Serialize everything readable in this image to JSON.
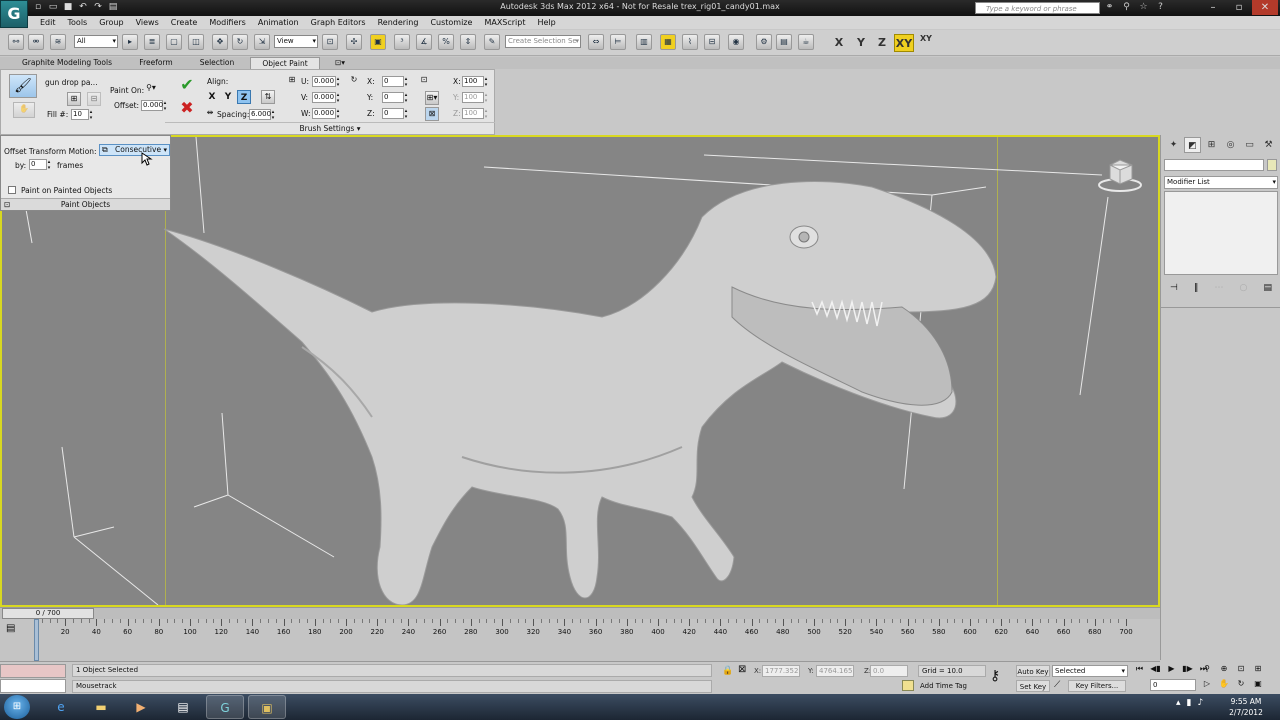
{
  "window": {
    "app_logo": "G",
    "title": "Autodesk 3ds Max  2012 x64  -  Not for Resale   trex_rig01_candy01.max",
    "search_placeholder": "Type a keyword or phrase"
  },
  "menu": [
    "Edit",
    "Tools",
    "Group",
    "Views",
    "Create",
    "Modifiers",
    "Animation",
    "Graph Editors",
    "Rendering",
    "Customize",
    "MAXScript",
    "Help"
  ],
  "toolbar": {
    "selection_filter": "All",
    "ref_coord": "View",
    "named_selection": "Create Selection Se",
    "axis_x": "X",
    "axis_y": "Y",
    "axis_z": "Z",
    "axis_xy": "XY",
    "axis_xy2": "XY"
  },
  "ribbon": {
    "tabs": [
      "Graphite Modeling Tools",
      "Freeform",
      "Selection",
      "Object Paint"
    ],
    "active_tab": "Object Paint",
    "brush_name": "gun drop pa...",
    "fill_label": "Fill #:",
    "fill_value": "10",
    "paint_on_label": "Paint On:",
    "offset_label": "Offset:",
    "offset_value": "0.000",
    "align_label": "Align:",
    "x": "X",
    "y": "Y",
    "z": "Z",
    "spacing_label": "Spacing:",
    "spacing_value": "6.000",
    "u_label": "U:",
    "u_value": "0.000",
    "v_label": "V:",
    "v_value": "0.000",
    "w_label": "W:",
    "w_value": "0.000",
    "rx_label": "X:",
    "rx_value": "0",
    "ry_label": "Y:",
    "ry_value": "0",
    "rz_label": "Z:",
    "rz_value": "0",
    "sx_label": "X:",
    "sx_value": "100",
    "sy_label": "Y:",
    "sy_value": "100",
    "sz_label": "Z:",
    "sz_value": "100",
    "brush_settings": "Brush Settings"
  },
  "flyout": {
    "offset_transform_label": "Offset Transform Motion:",
    "offset_transform_value": "Consecutive",
    "by_label": "by:",
    "by_value": "0",
    "frames_label": "frames",
    "paint_on_painted_label": "Paint on Painted Objects",
    "footer": "Paint Objects"
  },
  "command_panel": {
    "modifier_list": "Modifier List"
  },
  "timeline": {
    "slider_label": "0 / 700",
    "ticks": [
      "20",
      "40",
      "60",
      "80",
      "100",
      "120",
      "140",
      "160",
      "180",
      "200",
      "220",
      "240",
      "260",
      "280",
      "300",
      "320",
      "340",
      "360",
      "380",
      "400",
      "420",
      "440",
      "460",
      "480",
      "500",
      "520",
      "540",
      "560",
      "580",
      "600",
      "620",
      "640",
      "660",
      "680",
      "700"
    ]
  },
  "status": {
    "selection": "1 Object Selected",
    "prompt": "Mousetrack",
    "x_label": "X:",
    "x_value": "1777.352",
    "y_label": "Y:",
    "y_value": "4764.165",
    "z_label": "Z:",
    "z_value": "0.0",
    "grid": "Grid = 10.0",
    "add_time_tag": "Add Time Tag",
    "auto_key": "Auto Key",
    "set_key": "Set Key",
    "selected_set": "Selected",
    "key_filters": "Key Filters...",
    "current_frame": "0"
  },
  "taskbar": {
    "time": "9:55 AM",
    "date": "2/7/2012"
  },
  "colors": {
    "viewport_bg": "#858585",
    "viewport_border": "#d8d820",
    "active_axis": "#f0d020",
    "close_button": "#b33a2a"
  }
}
